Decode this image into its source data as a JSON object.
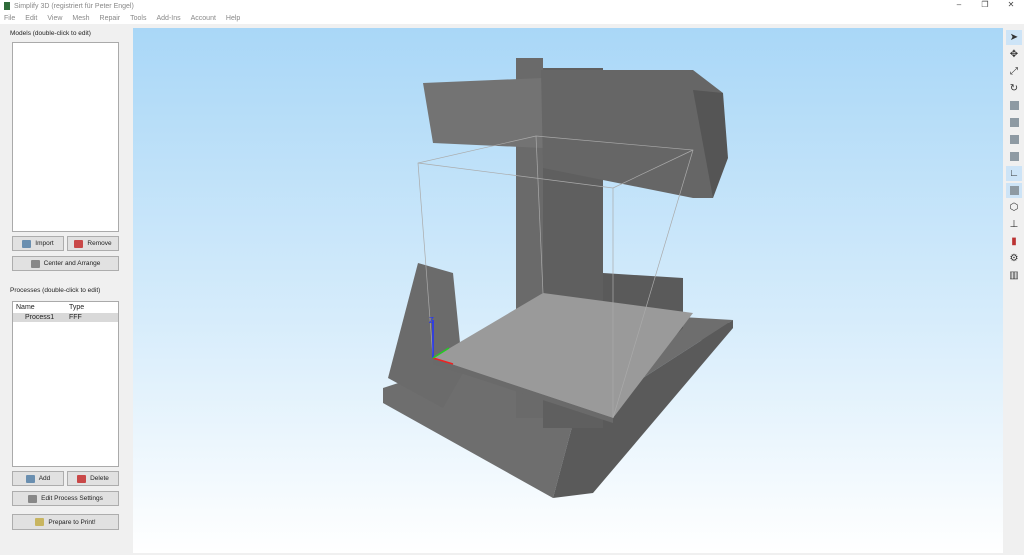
{
  "window": {
    "title": "Simplify 3D (registriert für Peter Engel)"
  },
  "menu": [
    "File",
    "Edit",
    "View",
    "Mesh",
    "Repair",
    "Tools",
    "Add-Ins",
    "Account",
    "Help"
  ],
  "models": {
    "label": "Models (double-click to edit)",
    "import": "Import",
    "remove": "Remove",
    "center": "Center and Arrange"
  },
  "processes": {
    "label": "Processes (double-click to edit)",
    "columns": [
      "Name",
      "Type"
    ],
    "rows": [
      {
        "name": "Process1",
        "type": "FFF"
      }
    ],
    "add": "Add",
    "delete": "Delete",
    "edit": "Edit Process Settings",
    "prepare": "Prepare to Print!"
  },
  "axis": {
    "z": "Z"
  }
}
